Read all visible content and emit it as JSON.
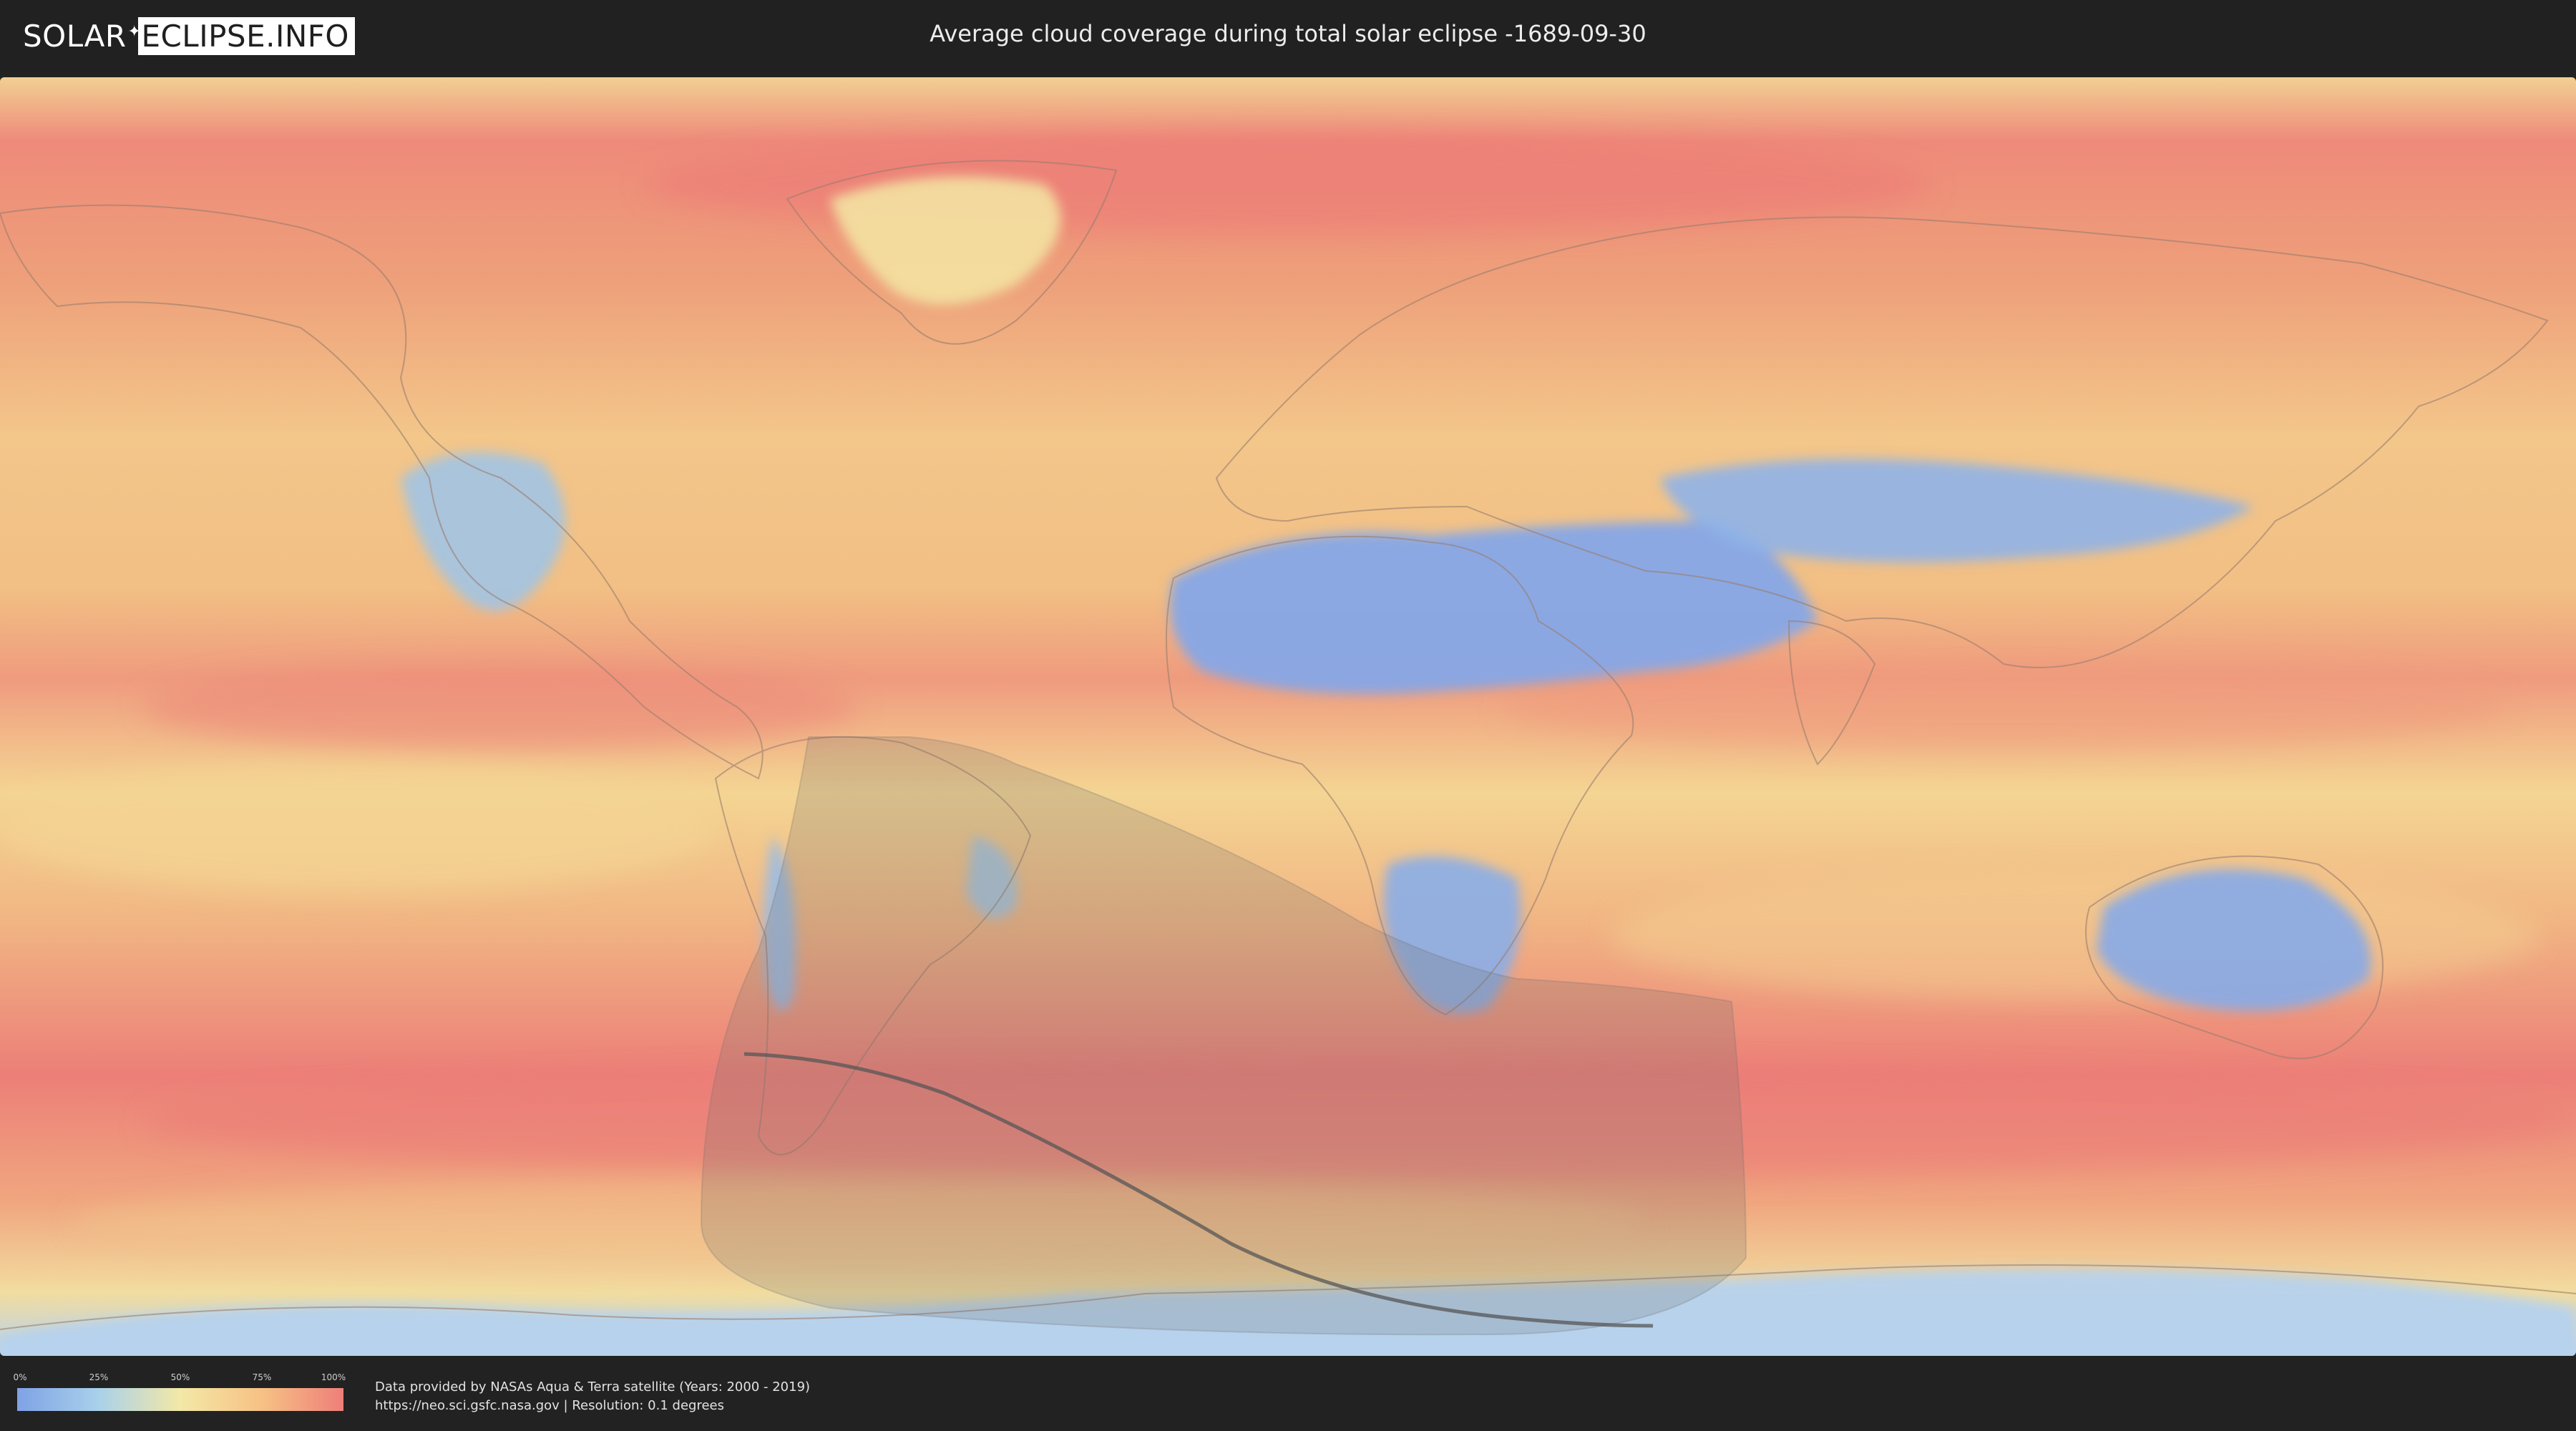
{
  "header": {
    "logo_left": "SOLAR",
    "logo_right": "ECLIPSE.INFO",
    "title": "Average cloud coverage during total solar eclipse -1689-09-30"
  },
  "map": {
    "colors": {
      "low": "#7ea2e6",
      "mid_low": "#a9d1ea",
      "mid": "#f3e8a6",
      "mid_high": "#f7c184",
      "high": "#ee7f7a",
      "eclipse_shade": "#6e6e6e"
    }
  },
  "legend": {
    "ticks": [
      "0%",
      "25%",
      "50%",
      "75%",
      "100%"
    ]
  },
  "footer": {
    "line1": "Data provided by NASAs Aqua & Terra satellite (Years: 2000 - 2019)",
    "line2": "https://neo.sci.gsfc.nasa.gov | Resolution: 0.1 degrees"
  }
}
